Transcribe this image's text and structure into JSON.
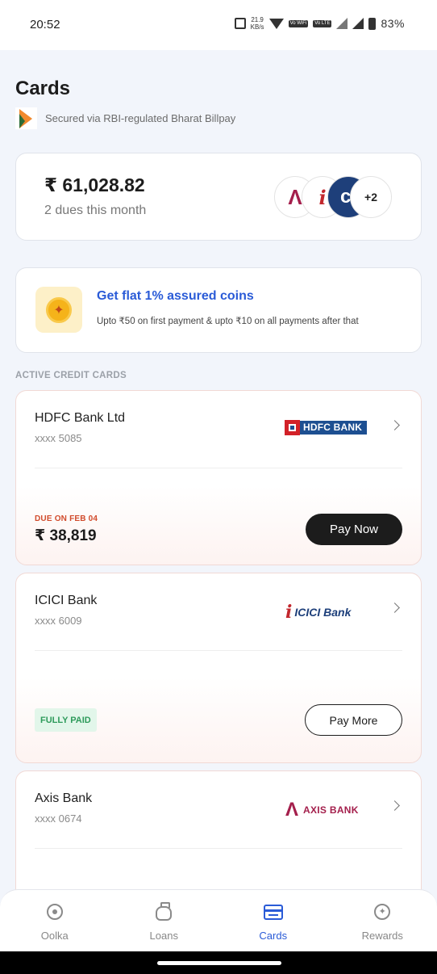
{
  "status_bar": {
    "time": "20:52",
    "speed": "21.9",
    "speed_unit": "KB/s",
    "sim1": "Vo WiFi",
    "sim2": "Vo LTE",
    "battery": "83%"
  },
  "header": {
    "title": "Cards",
    "subtitle": "Secured via RBI-regulated Bharat Billpay"
  },
  "dues": {
    "amount": "₹ 61,028.82",
    "subtitle": "2 dues this month",
    "more_banks": "+2"
  },
  "coins_offer": {
    "title": "Get flat 1% assured coins",
    "description": "Upto ₹50 on first payment & upto ₹10 on all payments after that"
  },
  "section_label": "ACTIVE CREDIT CARDS",
  "cards": [
    {
      "bank": "HDFC Bank Ltd",
      "number": "xxxx 5085",
      "logo_text": "HDFC BANK",
      "due_label": "DUE ON FEB 04",
      "due_amount": "₹ 38,819",
      "action": "Pay Now"
    },
    {
      "bank": "ICICI Bank",
      "number": "xxxx 6009",
      "logo_text": "ICICI Bank",
      "status": "FULLY PAID",
      "action": "Pay More"
    },
    {
      "bank": "Axis Bank",
      "number": "xxxx 0674",
      "logo_text": "AXIS BANK"
    }
  ],
  "bottom_nav": {
    "items": [
      {
        "label": "Oolka",
        "icon": "oolka-icon"
      },
      {
        "label": "Loans",
        "icon": "loans-icon"
      },
      {
        "label": "Cards",
        "icon": "cards-icon",
        "active": true
      },
      {
        "label": "Rewards",
        "icon": "rewards-icon"
      }
    ]
  },
  "colors": {
    "accent": "#2a5bd7",
    "due_red": "#d14b2c",
    "paid_green": "#2e9b5b",
    "dark_button": "#1c1c1c"
  }
}
